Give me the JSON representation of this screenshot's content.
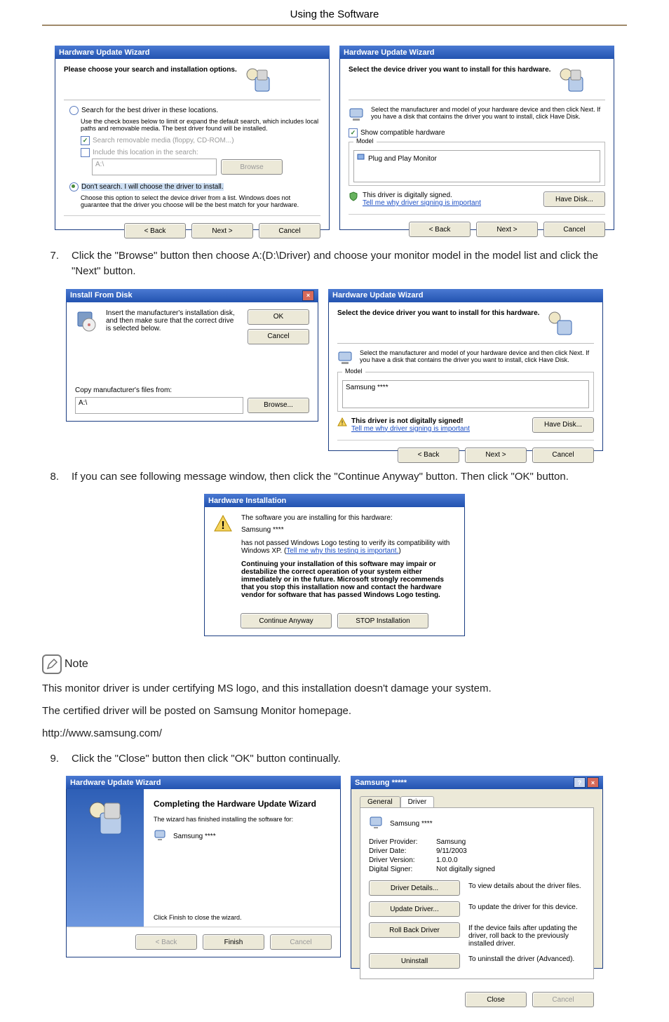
{
  "page_header": "Using the Software",
  "steps": {
    "s7": {
      "num": "7.",
      "text": "Click the \"Browse\" button then choose A:(D:\\Driver) and choose your monitor model in the model list and click the \"Next\" button."
    },
    "s8": {
      "num": "8.",
      "text": "If you can see following message window, then click the \"Continue Anyway\" button. Then click \"OK\" button."
    },
    "s9": {
      "num": "9.",
      "text": "Click the \"Close\" button then click \"OK\" button continually."
    }
  },
  "note": {
    "label": "Note"
  },
  "body": {
    "p1": "This monitor driver is under certifying MS logo, and this installation doesn't damage your system.",
    "p2": "The certified driver will be posted on Samsung Monitor homepage.",
    "p3": "http://www.samsung.com/"
  },
  "dlg_a": {
    "title": "Hardware Update Wizard",
    "header": "Please choose your search and installation options.",
    "r1": "Search for the best driver in these locations.",
    "r1_sub1": "Use the check boxes below to limit or expand the default search, which includes local paths and removable media. The best driver found will be installed.",
    "c1": "Search removable media (floppy, CD-ROM...)",
    "c2": "Include this location in the search:",
    "path": "A:\\",
    "browse": "Browse",
    "r2": "Don't search. I will choose the driver to install.",
    "r2_sub": "Choose this option to select the device driver from a list. Windows does not guarantee that the driver you choose will be the best match for your hardware.",
    "back": "< Back",
    "next": "Next >",
    "cancel": "Cancel"
  },
  "dlg_b": {
    "title": "Hardware Update Wizard",
    "header": "Select the device driver you want to install for this hardware.",
    "sub": "Select the manufacturer and model of your hardware device and then click Next. If you have a disk that contains the driver you want to install, click Have Disk.",
    "show_compat": "Show compatible hardware",
    "model": "Model",
    "item": "Plug and Play Monitor",
    "signed": "This driver is digitally signed.",
    "link": "Tell me why driver signing is important",
    "have_disk": "Have Disk...",
    "back": "< Back",
    "next": "Next >",
    "cancel": "Cancel"
  },
  "dlg_c": {
    "title": "Install From Disk",
    "text": "Insert the manufacturer's installation disk, and then make sure that the correct drive is selected below.",
    "ok": "OK",
    "cancel": "Cancel",
    "copy_label": "Copy manufacturer's files from:",
    "path": "A:\\",
    "browse": "Browse..."
  },
  "dlg_d": {
    "title": "Hardware Update Wizard",
    "header": "Select the device driver you want to install for this hardware.",
    "sub": "Select the manufacturer and model of your hardware device and then click Next. If you have a disk that contains the driver you want to install, click Have Disk.",
    "model": "Model",
    "item": "Samsung ****",
    "warn": "This driver is not digitally signed!",
    "link": "Tell me why driver signing is important",
    "have_disk": "Have Disk...",
    "back": "< Back",
    "next": "Next >",
    "cancel": "Cancel"
  },
  "dlg_e": {
    "title": "Hardware Installation",
    "l1": "The software you are installing for this hardware:",
    "name": "Samsung ****",
    "l2": "has not passed Windows Logo testing to verify its compatibility with Windows XP. (",
    "link": "Tell me why this testing is important.",
    "l2_tail": ")",
    "bold": "Continuing your installation of this software may impair or destabilize the correct operation of your system either immediately or in the future. Microsoft strongly recommends that you stop this installation now and contact the hardware vendor for software that has passed Windows Logo testing.",
    "cont": "Continue Anyway",
    "stop": "STOP Installation"
  },
  "dlg_f": {
    "title": "Hardware Update Wizard",
    "h1": "Completing the Hardware Update Wizard",
    "l1": "The wizard has finished installing the software for:",
    "name": "Samsung ****",
    "foot": "Click Finish to close the wizard.",
    "back": "< Back",
    "finish": "Finish",
    "cancel": "Cancel"
  },
  "dlg_g": {
    "title": "Samsung *****",
    "tab_general": "General",
    "tab_driver": "Driver",
    "name": "Samsung ****",
    "kv": {
      "provider_k": "Driver Provider:",
      "provider_v": "Samsung",
      "date_k": "Driver Date:",
      "date_v": "9/11/2003",
      "version_k": "Driver Version:",
      "version_v": "1.0.0.0",
      "signer_k": "Digital Signer:",
      "signer_v": "Not digitally signed"
    },
    "btns": {
      "details": "Driver Details...",
      "details_d": "To view details about the driver files.",
      "update": "Update Driver...",
      "update_d": "To update the driver for this device.",
      "roll": "Roll Back Driver",
      "roll_d": "If the device fails after updating the driver, roll back to the previously installed driver.",
      "uninstall": "Uninstall",
      "uninstall_d": "To uninstall the driver (Advanced)."
    },
    "close": "Close",
    "cancel": "Cancel"
  }
}
